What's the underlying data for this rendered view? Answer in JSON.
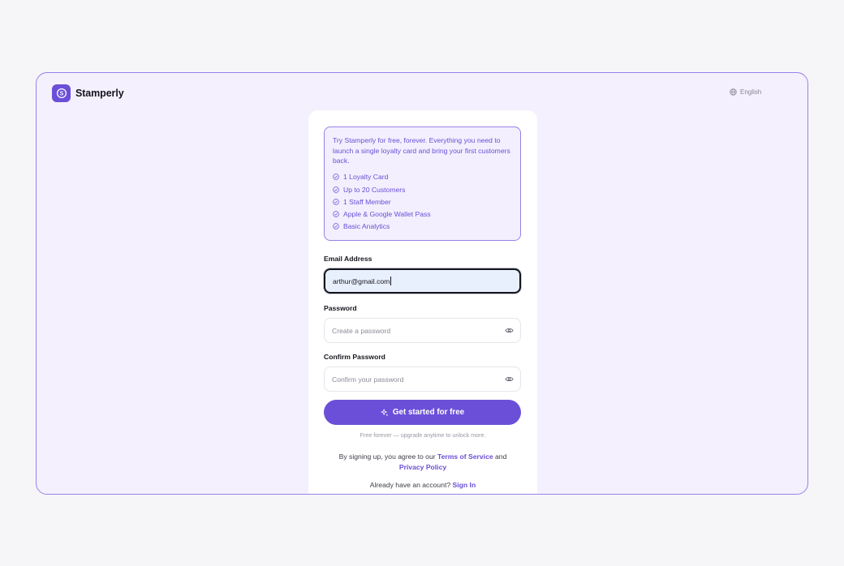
{
  "brand": {
    "name": "Stamperly",
    "logo_icon": "stamp-s-icon",
    "accent": "#6b4fd8"
  },
  "header": {
    "language_label": "English",
    "language_icon": "globe-icon"
  },
  "promo": {
    "text": "Try Stamperly for free, forever. Everything you need to launch a single loyalty card and bring your first customers back.",
    "features": [
      {
        "label": "1 Loyalty Card",
        "icon": "check-circle-icon"
      },
      {
        "label": "Up to 20 Customers",
        "icon": "check-circle-icon"
      },
      {
        "label": "1 Staff Member",
        "icon": "check-circle-icon"
      },
      {
        "label": "Apple & Google Wallet Pass",
        "icon": "check-circle-icon"
      },
      {
        "label": "Basic Analytics",
        "icon": "check-circle-icon"
      }
    ]
  },
  "form": {
    "email": {
      "label": "Email Address",
      "value": "arthur@gmail.com"
    },
    "password": {
      "label": "Password",
      "placeholder": "Create a password",
      "icon": "eye-icon"
    },
    "confirm": {
      "label": "Confirm Password",
      "placeholder": "Confirm your password",
      "icon": "eye-icon"
    },
    "submit": {
      "label": "Get started for free",
      "icon": "sparkle-icon"
    },
    "note": "Free forever — upgrade anytime to unlock more."
  },
  "legal": {
    "prefix": "By signing up, you agree to our",
    "terms_link": "Terms of Service",
    "and": "and",
    "privacy_link": "Privacy Policy"
  },
  "signin": {
    "prompt": "Already have an account?",
    "link": "Sign In"
  }
}
